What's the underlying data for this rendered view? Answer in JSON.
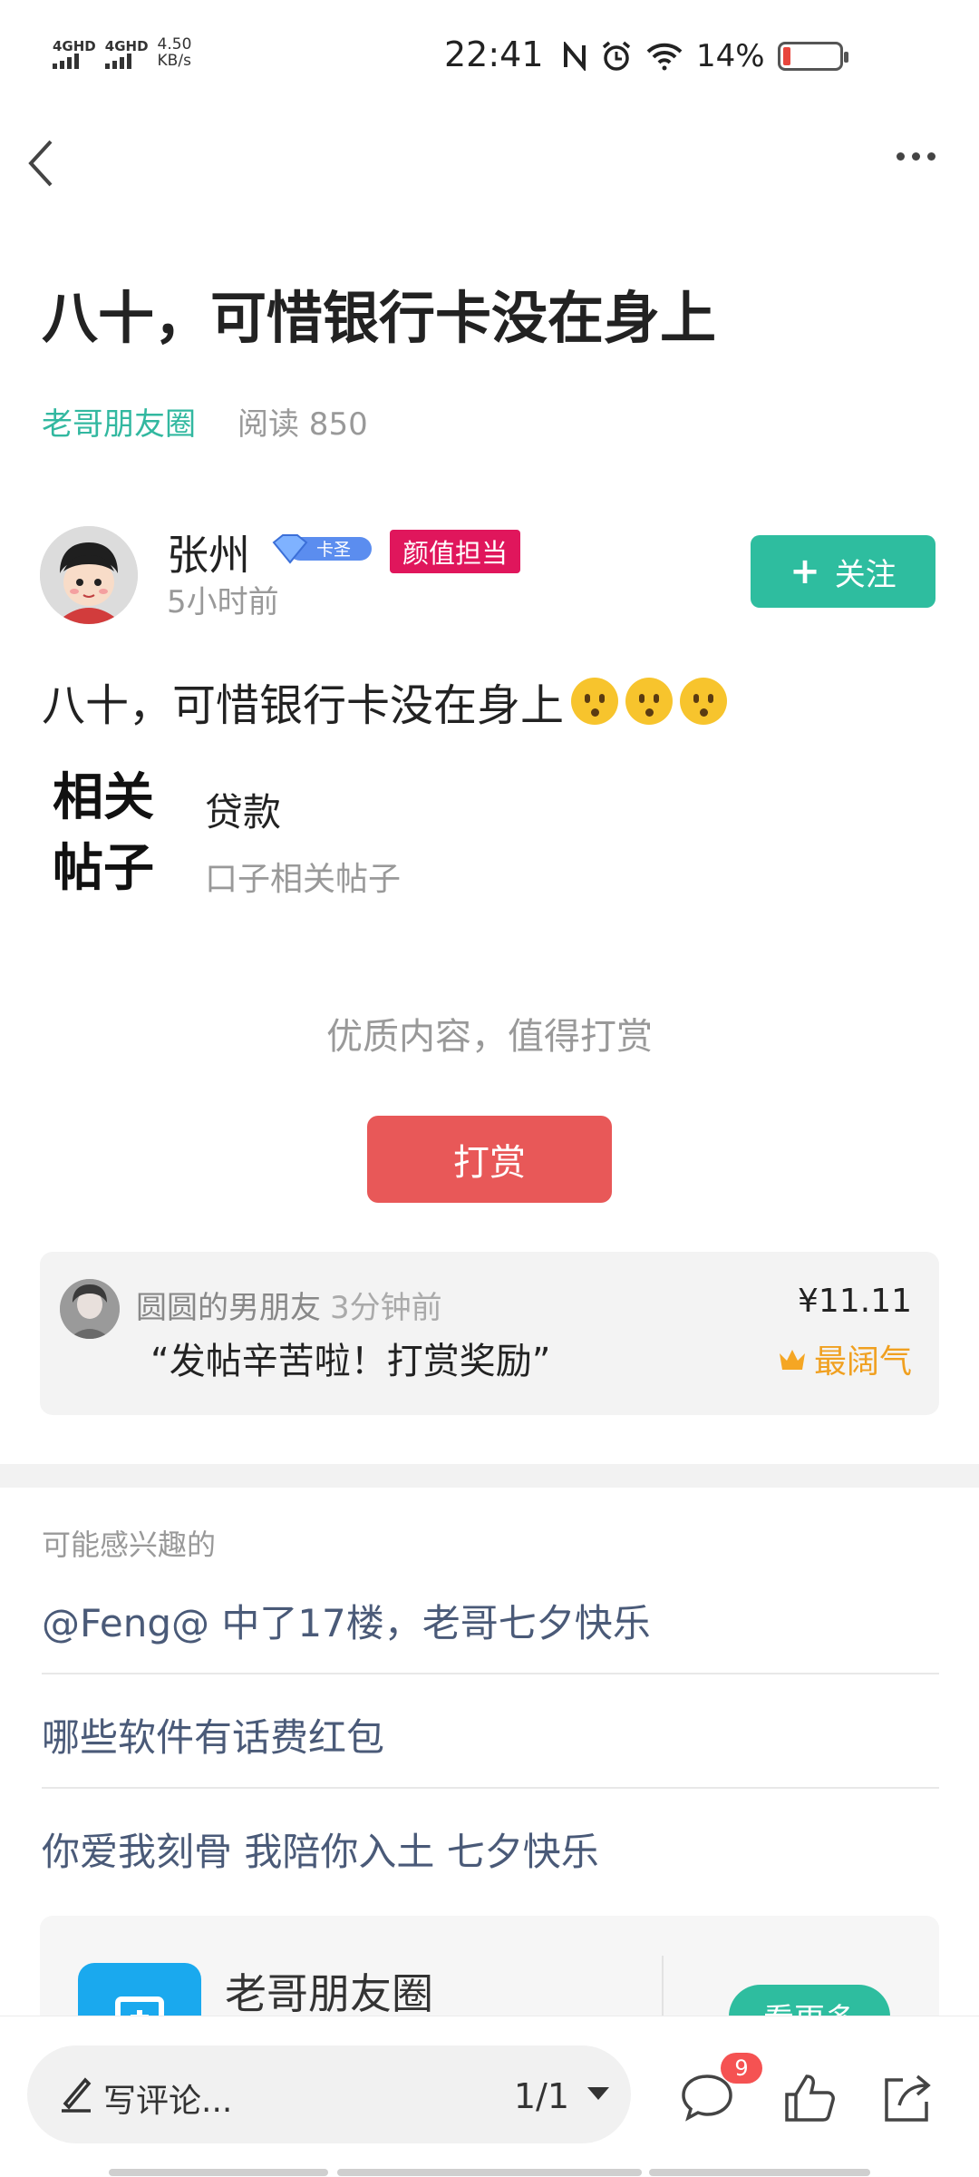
{
  "status_bar": {
    "sim1_label": "4GHD",
    "sim2_label": "4GHD",
    "net_speed_value": "4.50",
    "net_speed_unit": "KB/s",
    "time": "22:41",
    "battery_percent": "14%",
    "battery_level": 0.14,
    "icons": [
      "nfc-icon",
      "alarm-icon",
      "wifi-icon",
      "battery-icon"
    ]
  },
  "nav": {
    "back_icon": "back-icon",
    "more_icon": "more-icon"
  },
  "post": {
    "title": "八十，可惜银行卡没在身上",
    "group": "老哥朋友圈",
    "reads": "阅读 850",
    "author": {
      "name": "张州",
      "level_badge": "卡圣",
      "title_badge": "颜值担当",
      "time": "5小时前"
    },
    "follow_label": "关注",
    "content": "八十，可惜银行卡没在身上",
    "emoji_count": 3,
    "related": {
      "title": "相关帖子",
      "item_1": "贷款",
      "item_2": "口子相关帖子"
    },
    "reward_tip": "优质内容，值得打赏",
    "reward_button": "打赏"
  },
  "reward_record": {
    "user": "圆圆的男朋友",
    "time": "3分钟前",
    "message": "“发帖辛苦啦！打赏奖励”",
    "amount": "¥11.11",
    "tag": "最阔气"
  },
  "interest": {
    "title": "可能感兴趣的",
    "items": [
      "@Feng@ 中了17楼，老哥七夕快乐",
      "哪些软件有话费红包",
      "你爱我刻骨 我陪你入土 七夕快乐"
    ]
  },
  "group_card": {
    "name": "老哥朋友圈",
    "button": "看更多"
  },
  "bottom_bar": {
    "comment_placeholder": "写评论...",
    "page": "1/1",
    "comment_count": "9"
  },
  "colors": {
    "accent_green": "#2ebd9f",
    "reward_red": "#e85858",
    "badge_pink": "#e0165c",
    "link_blue_gray": "#4a5a78"
  }
}
